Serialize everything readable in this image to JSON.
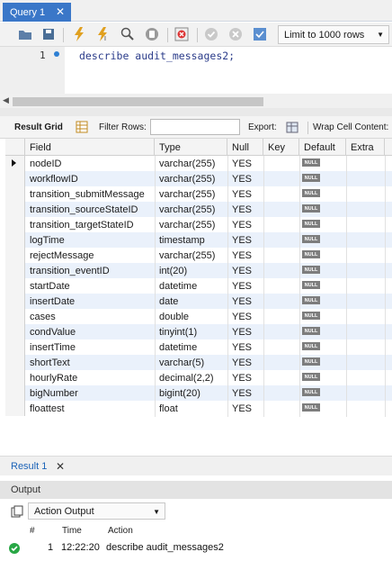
{
  "tabs": [
    {
      "label": "Query 1"
    }
  ],
  "toolbar": {
    "icons": [
      "folder-icon",
      "save-icon",
      "execute-icon",
      "execute-current-icon",
      "explain-icon",
      "stop-icon",
      "toggle-error-icon",
      "commit-icon",
      "rollback-icon",
      "autocommit-icon"
    ],
    "limit_label": "Limit to 1000 rows"
  },
  "editor": {
    "line_number": "1",
    "code": "describe audit_messages2;"
  },
  "result_toolbar": {
    "result_grid_label": "Result Grid",
    "filter_rows_label": "Filter Rows:",
    "filter_value": "",
    "export_label": "Export:",
    "wrap_label": "Wrap Cell Content:"
  },
  "grid": {
    "columns": [
      "Field",
      "Type",
      "Null",
      "Key",
      "Default",
      "Extra"
    ],
    "null_badge": "NULL",
    "rows": [
      {
        "field": "nodeID",
        "type": "varchar(255)",
        "null": "YES",
        "key": "",
        "default": "NULL",
        "extra": ""
      },
      {
        "field": "workflowID",
        "type": "varchar(255)",
        "null": "YES",
        "key": "",
        "default": "NULL",
        "extra": ""
      },
      {
        "field": "transition_submitMessage",
        "type": "varchar(255)",
        "null": "YES",
        "key": "",
        "default": "NULL",
        "extra": ""
      },
      {
        "field": "transition_sourceStateID",
        "type": "varchar(255)",
        "null": "YES",
        "key": "",
        "default": "NULL",
        "extra": ""
      },
      {
        "field": "transition_targetStateID",
        "type": "varchar(255)",
        "null": "YES",
        "key": "",
        "default": "NULL",
        "extra": ""
      },
      {
        "field": "logTime",
        "type": "timestamp",
        "null": "YES",
        "key": "",
        "default": "NULL",
        "extra": ""
      },
      {
        "field": "rejectMessage",
        "type": "varchar(255)",
        "null": "YES",
        "key": "",
        "default": "NULL",
        "extra": ""
      },
      {
        "field": "transition_eventID",
        "type": "int(20)",
        "null": "YES",
        "key": "",
        "default": "NULL",
        "extra": ""
      },
      {
        "field": "startDate",
        "type": "datetime",
        "null": "YES",
        "key": "",
        "default": "NULL",
        "extra": ""
      },
      {
        "field": "insertDate",
        "type": "date",
        "null": "YES",
        "key": "",
        "default": "NULL",
        "extra": ""
      },
      {
        "field": "cases",
        "type": "double",
        "null": "YES",
        "key": "",
        "default": "NULL",
        "extra": ""
      },
      {
        "field": "condValue",
        "type": "tinyint(1)",
        "null": "YES",
        "key": "",
        "default": "NULL",
        "extra": ""
      },
      {
        "field": "insertTime",
        "type": "datetime",
        "null": "YES",
        "key": "",
        "default": "NULL",
        "extra": ""
      },
      {
        "field": "shortText",
        "type": "varchar(5)",
        "null": "YES",
        "key": "",
        "default": "NULL",
        "extra": ""
      },
      {
        "field": "hourlyRate",
        "type": "decimal(2,2)",
        "null": "YES",
        "key": "",
        "default": "NULL",
        "extra": ""
      },
      {
        "field": "bigNumber",
        "type": "bigint(20)",
        "null": "YES",
        "key": "",
        "default": "NULL",
        "extra": ""
      },
      {
        "field": "floattest",
        "type": "float",
        "null": "YES",
        "key": "",
        "default": "NULL",
        "extra": ""
      }
    ]
  },
  "result_tab": {
    "label": "Result 1"
  },
  "output": {
    "title": "Output",
    "mode": "Action Output",
    "columns": [
      "#",
      "Time",
      "Action"
    ],
    "entries": [
      {
        "num": "1",
        "time": "12:22:20",
        "action": "describe audit_messages2"
      }
    ]
  },
  "colors": {
    "tab_active": "#3a77c8",
    "row_alt": "#eaf1fb",
    "ok": "#28a745"
  }
}
